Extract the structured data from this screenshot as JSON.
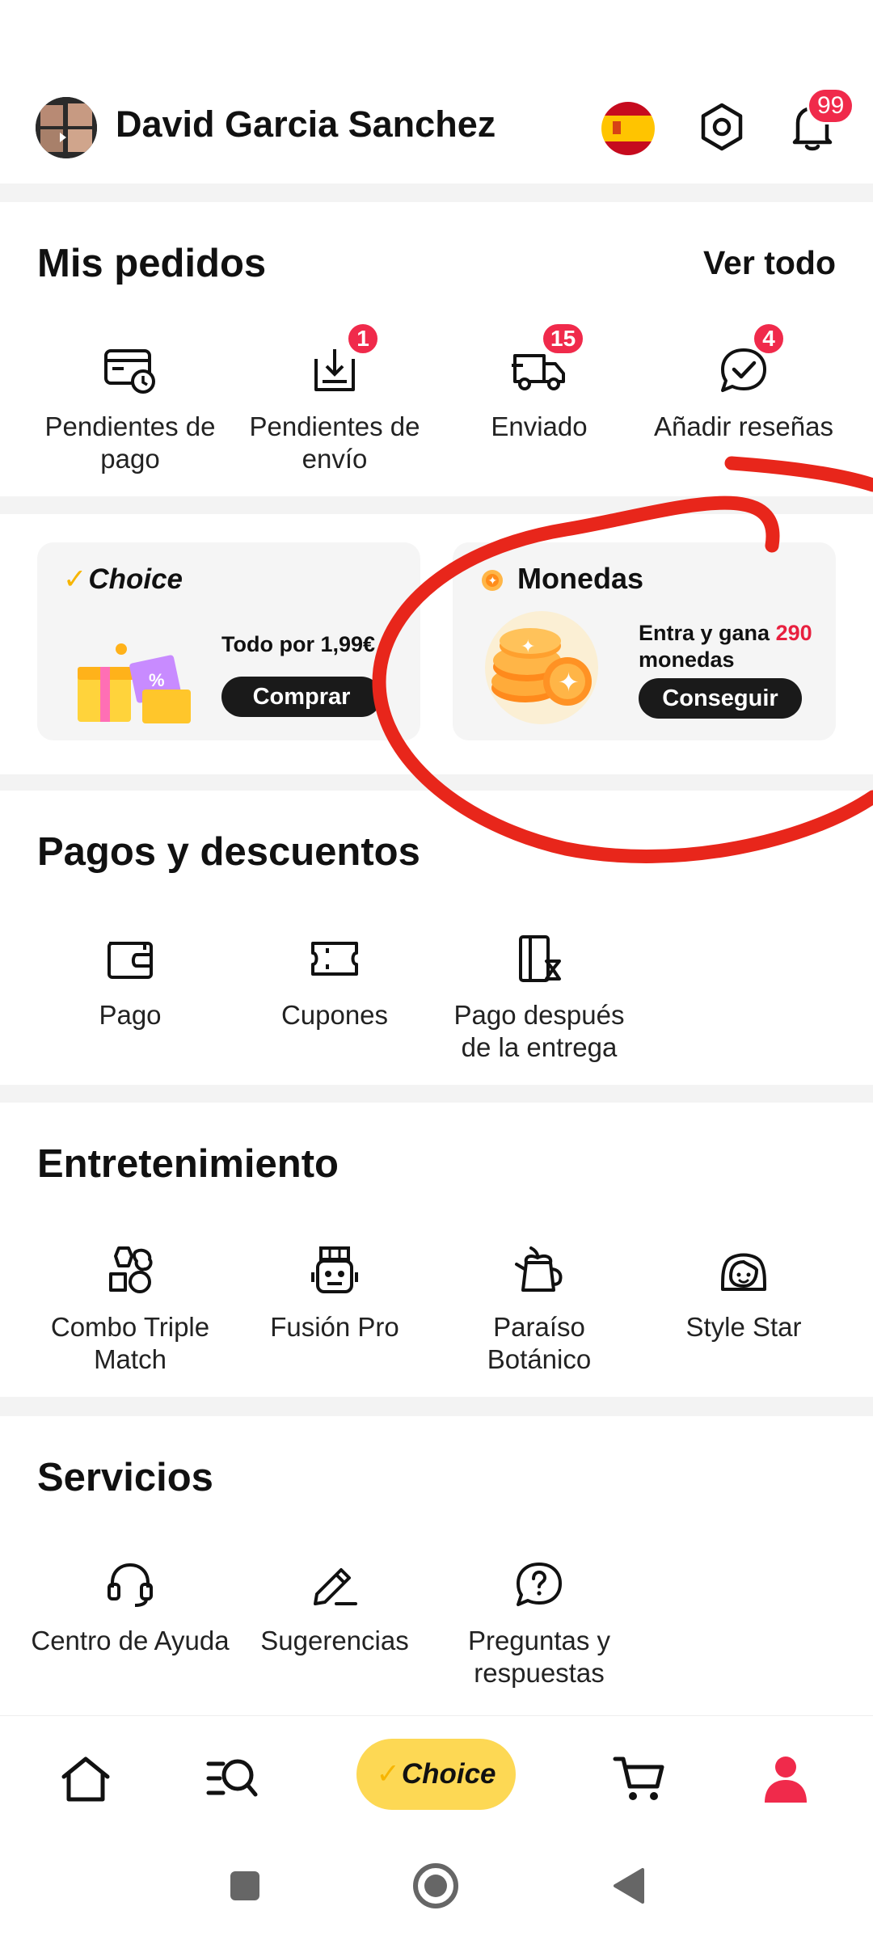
{
  "header": {
    "username": "David Garcia Sanchez",
    "notification_count": "99"
  },
  "orders": {
    "title": "Mis pedidos",
    "see_all": "Ver todo",
    "items": [
      {
        "label": "Pendientes de pago",
        "icon": "wallet-clock-icon",
        "badge": ""
      },
      {
        "label": "Pendientes de envío",
        "icon": "package-download-icon",
        "badge": "1"
      },
      {
        "label": "Enviado",
        "icon": "truck-icon",
        "badge": "15"
      },
      {
        "label": "Añadir reseñas",
        "icon": "chat-check-icon",
        "badge": "4"
      }
    ]
  },
  "promo": {
    "choice": {
      "logo": "Choice",
      "text": "Todo por 1,99€",
      "button": "Comprar"
    },
    "coins": {
      "title": "Monedas",
      "text_prefix": "Entra y gana",
      "amount": "290",
      "text_suffix": "monedas",
      "button": "Conseguir"
    }
  },
  "payments": {
    "title": "Pagos y descuentos",
    "items": [
      {
        "label": "Pago",
        "icon": "wallet-icon"
      },
      {
        "label": "Cupones",
        "icon": "ticket-icon"
      },
      {
        "label": "Pago después de la entrega",
        "icon": "door-hourglass-icon"
      }
    ]
  },
  "entertainment": {
    "title": "Entretenimiento",
    "items": [
      {
        "label": "Combo Triple Match",
        "icon": "shapes-icon"
      },
      {
        "label": "Fusión Pro",
        "icon": "robot-icon"
      },
      {
        "label": "Paraíso Botánico",
        "icon": "watering-can-icon"
      },
      {
        "label": "Style Star",
        "icon": "girl-face-icon"
      }
    ]
  },
  "services": {
    "title": "Servicios",
    "items": [
      {
        "label": "Centro de Ayuda",
        "icon": "headset-icon"
      },
      {
        "label": "Sugerencias",
        "icon": "pencil-icon"
      },
      {
        "label": "Preguntas y respuestas",
        "icon": "question-bubble-icon"
      }
    ]
  },
  "bottom_nav": {
    "choice": "Choice",
    "active_color": "#f02a4b"
  },
  "colors": {
    "accent": "#f02a4b",
    "choice_yellow": "#fdd854",
    "annotation_red": "#e8261b"
  }
}
